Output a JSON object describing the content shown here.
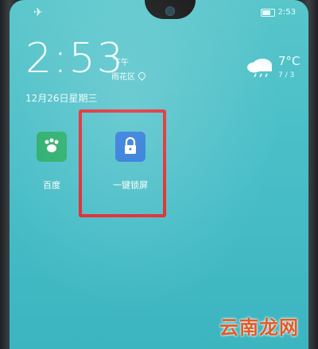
{
  "status_bar": {
    "left_icon": "airplane-icon",
    "right_text": "2:53",
    "battery_icon": "battery-icon"
  },
  "lockscreen": {
    "time": "2:53",
    "ampm": "下午",
    "district": "雨花区",
    "date": "12月26日星期三"
  },
  "weather": {
    "icon": "cloudy-rain-icon",
    "temperature": "7°C",
    "range": "7 / 3"
  },
  "apps": [
    {
      "label": "百度",
      "icon": "paw-icon",
      "color": "#27ad6a"
    },
    {
      "label": "一键锁屏",
      "icon": "lock-icon",
      "color": "#2675d9"
    }
  ],
  "annotation": {
    "color": "#e2222a"
  },
  "watermark": {
    "text": "云南龙网"
  }
}
